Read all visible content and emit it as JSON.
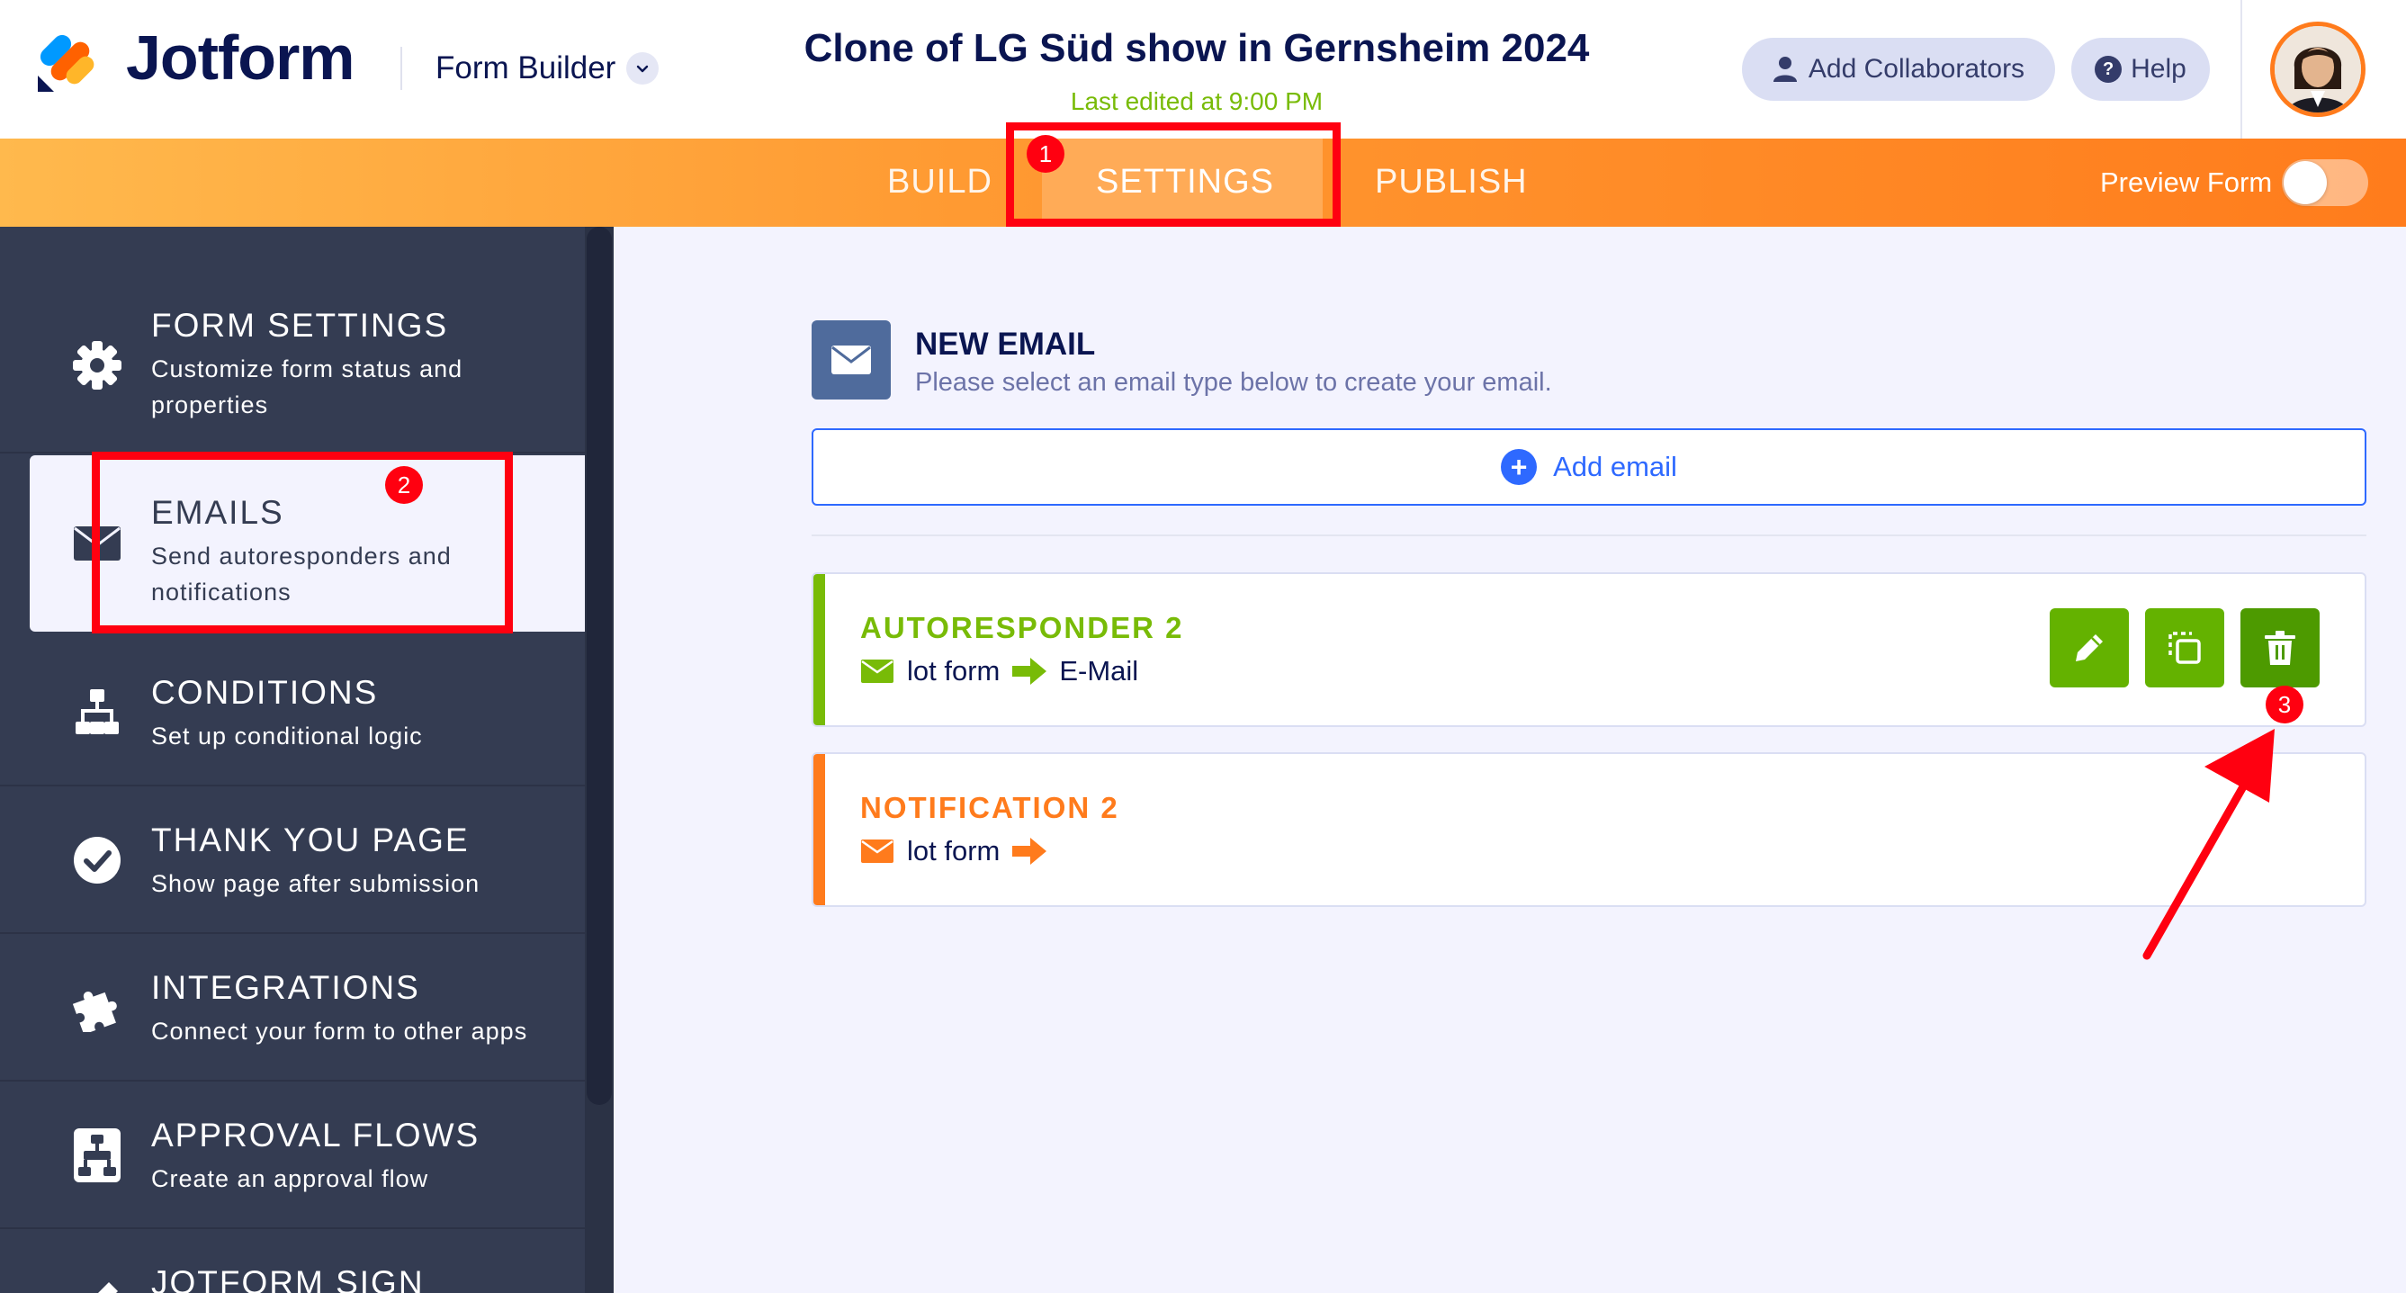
{
  "header": {
    "brand": "Jotform",
    "builder_label": "Form Builder",
    "form_title": "Clone of LG Süd show in Gernsheim 2024",
    "last_edited": "Last edited at 9:00 PM",
    "collaborators_label": "Add Collaborators",
    "help_label": "Help"
  },
  "nav": {
    "tabs": [
      {
        "label": "BUILD",
        "active": false
      },
      {
        "label": "SETTINGS",
        "active": true
      },
      {
        "label": "PUBLISH",
        "active": false
      }
    ],
    "preview_label": "Preview Form",
    "preview_on": false
  },
  "sidebar": {
    "items": [
      {
        "title": "FORM SETTINGS",
        "desc": "Customize form status and properties",
        "icon": "gear-icon"
      },
      {
        "title": "EMAILS",
        "desc": "Send autoresponders and notifications",
        "icon": "envelope-icon",
        "active": true
      },
      {
        "title": "CONDITIONS",
        "desc": "Set up conditional logic",
        "icon": "flow-icon"
      },
      {
        "title": "THANK YOU PAGE",
        "desc": "Show page after submission",
        "icon": "check-circle-icon"
      },
      {
        "title": "INTEGRATIONS",
        "desc": "Connect your form to other apps",
        "icon": "puzzle-icon"
      },
      {
        "title": "APPROVAL FLOWS",
        "desc": "Create an approval flow",
        "icon": "approval-icon"
      },
      {
        "title": "JOTFORM SIGN",
        "desc": "",
        "icon": "sign-icon"
      }
    ]
  },
  "main": {
    "new_email_title": "NEW EMAIL",
    "new_email_sub": "Please select an email type below to create your email.",
    "add_email_label": "Add email",
    "emails": [
      {
        "title": "AUTORESPONDER 2",
        "from": "lot form",
        "to": "E-Mail",
        "color": "#78bb07"
      },
      {
        "title": "NOTIFICATION 2",
        "from": "lot form",
        "to": "",
        "color": "#ff7b1c"
      }
    ]
  },
  "annotations": {
    "badges": [
      "1",
      "2",
      "3"
    ],
    "color": "#ff0010"
  }
}
